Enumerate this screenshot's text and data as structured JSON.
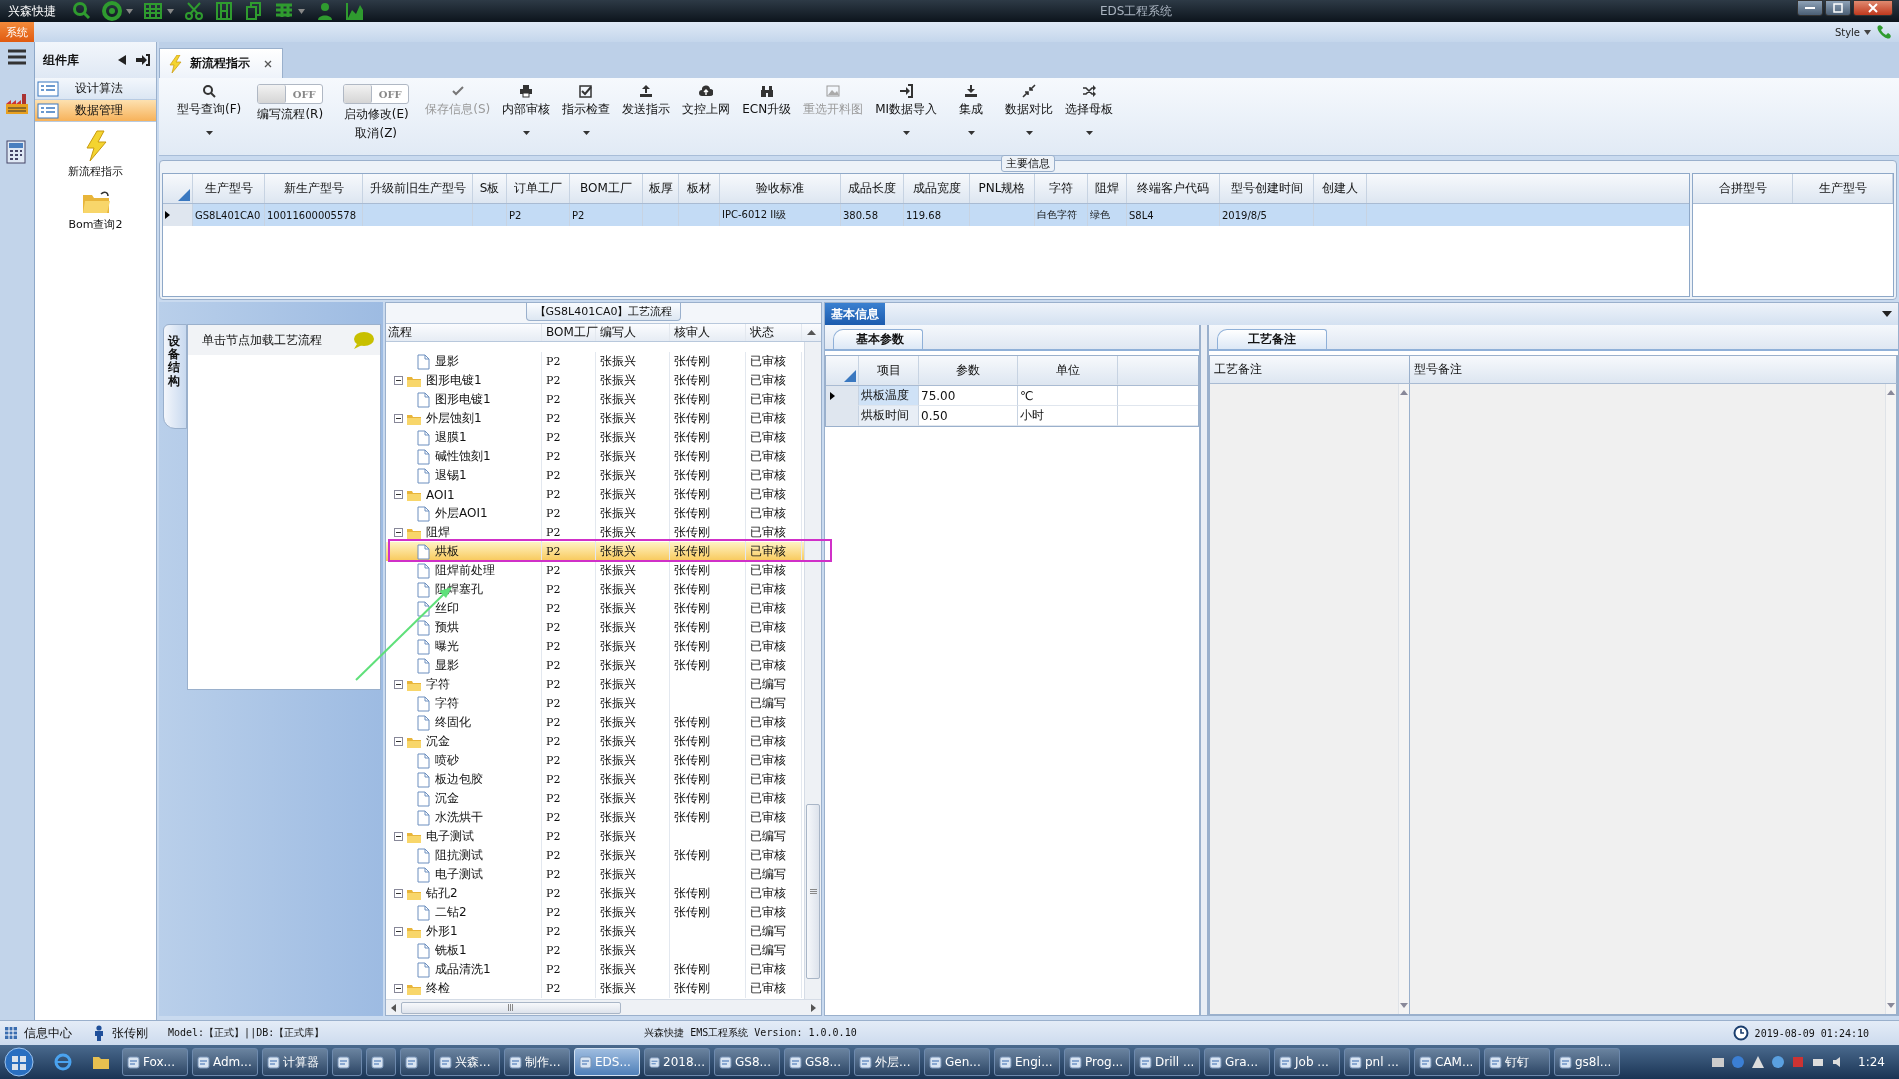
{
  "app": {
    "brand": "兴森快捷",
    "title": "EDS工程系统"
  },
  "ribbon": {
    "tab": "系统",
    "style_label": "Style"
  },
  "component_library": {
    "title": "组件库",
    "categories": [
      {
        "label": "设计算法",
        "selected": false
      },
      {
        "label": "数据管理",
        "selected": true
      }
    ],
    "items": [
      {
        "label": "新流程指示",
        "kind": "flash"
      },
      {
        "label": "Bom查询2",
        "kind": "folder"
      }
    ]
  },
  "document_tab": {
    "label": "新流程指示"
  },
  "toolbar": [
    {
      "kind": "button",
      "label": "型号查询(F)",
      "disabled": false,
      "dropdown": true
    },
    {
      "kind": "toggle",
      "label": "编写流程(R)",
      "state_text": "OFF",
      "on": false
    },
    {
      "kind": "toggle",
      "label": "启动修改(E)",
      "sublabel": "取消(Z)",
      "state_text": "OFF",
      "on": false
    },
    {
      "kind": "button",
      "label": "保存信息(S)",
      "disabled": true,
      "dropdown": false
    },
    {
      "kind": "button",
      "label": "内部审核",
      "disabled": false,
      "dropdown": true
    },
    {
      "kind": "button",
      "label": "指示检查",
      "disabled": false,
      "dropdown": true
    },
    {
      "kind": "button",
      "label": "发送指示",
      "disabled": false,
      "dropdown": false
    },
    {
      "kind": "button",
      "label": "文控上网",
      "disabled": false,
      "dropdown": false
    },
    {
      "kind": "button",
      "label": "ECN升级",
      "disabled": false,
      "dropdown": false
    },
    {
      "kind": "button",
      "label": "重选开料图",
      "disabled": true,
      "dropdown": false
    },
    {
      "kind": "button",
      "label": "MI数据导入",
      "disabled": false,
      "dropdown": true
    },
    {
      "kind": "button",
      "label": "集成",
      "disabled": false,
      "dropdown": true
    },
    {
      "kind": "button",
      "label": "数据对比",
      "disabled": false,
      "dropdown": true
    },
    {
      "kind": "button",
      "label": "选择母板",
      "disabled": false,
      "dropdown": true
    }
  ],
  "main_info": {
    "title": "主要信息",
    "columns": [
      "生产型号",
      "新生产型号",
      "升级前旧生产型号",
      "S板",
      "订单工厂",
      "BOM工厂",
      "板厚",
      "板材",
      "验收标准",
      "成品长度",
      "成品宽度",
      "PNL规格",
      "字符",
      "阻焊",
      "终端客户代码",
      "型号创建时间",
      "创建人"
    ],
    "rows": [
      {
        "selected": true,
        "cells": [
          "GS8L401CA0",
          "10011600005578",
          null,
          null,
          "P2",
          "P2",
          null,
          null,
          "IPC-6012 II级",
          "380.58",
          "119.68",
          null,
          "白色字符",
          "绿色",
          "S8L4",
          "2019/8/5",
          null
        ]
      }
    ],
    "merge_columns": [
      "合拼型号",
      "生产型号"
    ]
  },
  "side_panel": {
    "tab": "设备结构",
    "hint": "单击节点加载工艺流程"
  },
  "process_tree": {
    "title": "【GS8L401CA0】工艺流程",
    "columns": [
      "流程",
      "BOM工厂",
      "编写人",
      "核审人",
      "状态"
    ],
    "nodes": [
      {
        "children": [
          {
            "name": "显影",
            "bom": "P2",
            "writer": "张振兴",
            "reviewer": "张传刚",
            "status": "已审核",
            "selected": false
          }
        ]
      },
      {
        "name": "图形电镀1",
        "bom": "P2",
        "writer": "张振兴",
        "reviewer": "张传刚",
        "status": "已审核",
        "selected": false,
        "expanded": true,
        "children": [
          {
            "name": "图形电镀1",
            "bom": "P2",
            "writer": "张振兴",
            "reviewer": "张传刚",
            "status": "已审核",
            "selected": false
          }
        ]
      },
      {
        "name": "外层蚀刻1",
        "bom": "P2",
        "writer": "张振兴",
        "reviewer": "张传刚",
        "status": "已审核",
        "selected": false,
        "expanded": true,
        "children": [
          {
            "name": "退膜1",
            "bom": "P2",
            "writer": "张振兴",
            "reviewer": "张传刚",
            "status": "已审核",
            "selected": false
          },
          {
            "name": "碱性蚀刻1",
            "bom": "P2",
            "writer": "张振兴",
            "reviewer": "张传刚",
            "status": "已审核",
            "selected": false
          },
          {
            "name": "退锡1",
            "bom": "P2",
            "writer": "张振兴",
            "reviewer": "张传刚",
            "status": "已审核",
            "selected": false
          }
        ]
      },
      {
        "name": "AOI1",
        "bom": "P2",
        "writer": "张振兴",
        "reviewer": "张传刚",
        "status": "已审核",
        "selected": false,
        "expanded": true,
        "children": [
          {
            "name": "外层AOI1",
            "bom": "P2",
            "writer": "张振兴",
            "reviewer": "张传刚",
            "status": "已审核",
            "selected": false
          }
        ]
      },
      {
        "name": "阻焊",
        "bom": "P2",
        "writer": "张振兴",
        "reviewer": "张传刚",
        "status": "已审核",
        "selected": false,
        "expanded": true,
        "children": [
          {
            "name": "烘板",
            "bom": "P2",
            "writer": "张振兴",
            "reviewer": "张传刚",
            "status": "已审核",
            "selected": true
          },
          {
            "name": "阻焊前处理",
            "bom": "P2",
            "writer": "张振兴",
            "reviewer": "张传刚",
            "status": "已审核",
            "selected": false
          },
          {
            "name": "阻焊塞孔",
            "bom": "P2",
            "writer": "张振兴",
            "reviewer": "张传刚",
            "status": "已审核",
            "selected": false
          },
          {
            "name": "丝印",
            "bom": "P2",
            "writer": "张振兴",
            "reviewer": "张传刚",
            "status": "已审核",
            "selected": false
          },
          {
            "name": "预烘",
            "bom": "P2",
            "writer": "张振兴",
            "reviewer": "张传刚",
            "status": "已审核",
            "selected": false
          },
          {
            "name": "曝光",
            "bom": "P2",
            "writer": "张振兴",
            "reviewer": "张传刚",
            "status": "已审核",
            "selected": false
          },
          {
            "name": "显影",
            "bom": "P2",
            "writer": "张振兴",
            "reviewer": "张传刚",
            "status": "已审核",
            "selected": false
          }
        ]
      },
      {
        "name": "字符",
        "bom": "P2",
        "writer": "张振兴",
        "status": "已编写",
        "selected": false,
        "expanded": true,
        "children": [
          {
            "name": "字符",
            "bom": "P2",
            "writer": "张振兴",
            "status": "已编写",
            "selected": false
          },
          {
            "name": "终固化",
            "bom": "P2",
            "writer": "张振兴",
            "reviewer": "张传刚",
            "status": "已审核",
            "selected": false
          }
        ]
      },
      {
        "name": "沉金",
        "bom": "P2",
        "writer": "张振兴",
        "reviewer": "张传刚",
        "status": "已审核",
        "selected": false,
        "expanded": true,
        "children": [
          {
            "name": "喷砂",
            "bom": "P2",
            "writer": "张振兴",
            "reviewer": "张传刚",
            "status": "已审核",
            "selected": false
          },
          {
            "name": "板边包胶",
            "bom": "P2",
            "writer": "张振兴",
            "reviewer": "张传刚",
            "status": "已审核",
            "selected": false
          },
          {
            "name": "沉金",
            "bom": "P2",
            "writer": "张振兴",
            "reviewer": "张传刚",
            "status": "已审核",
            "selected": false
          },
          {
            "name": "水洗烘干",
            "bom": "P2",
            "writer": "张振兴",
            "reviewer": "张传刚",
            "status": "已审核",
            "selected": false
          }
        ]
      },
      {
        "name": "电子测试",
        "bom": "P2",
        "writer": "张振兴",
        "status": "已编写",
        "selected": false,
        "expanded": true,
        "children": [
          {
            "name": "阻抗测试",
            "bom": "P2",
            "writer": "张振兴",
            "reviewer": "张传刚",
            "status": "已审核",
            "selected": false
          },
          {
            "name": "电子测试",
            "bom": "P2",
            "writer": "张振兴",
            "status": "已编写",
            "selected": false
          }
        ]
      },
      {
        "name": "钻孔2",
        "bom": "P2",
        "writer": "张振兴",
        "reviewer": "张传刚",
        "status": "已审核",
        "selected": false,
        "expanded": true,
        "children": [
          {
            "name": "二钻2",
            "bom": "P2",
            "writer": "张振兴",
            "reviewer": "张传刚",
            "status": "已审核",
            "selected": false
          }
        ]
      },
      {
        "name": "外形1",
        "bom": "P2",
        "writer": "张振兴",
        "status": "已编写",
        "selected": false,
        "expanded": true,
        "children": [
          {
            "name": "铣板1",
            "bom": "P2",
            "writer": "张振兴",
            "status": "已编写",
            "selected": false
          },
          {
            "name": "成品清洗1",
            "bom": "P2",
            "writer": "张振兴",
            "reviewer": "张传刚",
            "status": "已审核",
            "selected": false
          }
        ]
      },
      {
        "name": "终检",
        "bom": "P2",
        "writer": "张振兴",
        "reviewer": "张传刚",
        "status": "已审核",
        "selected": false,
        "expanded": true
      }
    ]
  },
  "basic_info": {
    "tab": "基本信息",
    "params": {
      "tab": "基本参数",
      "columns": [
        "项目",
        "参数",
        "单位"
      ],
      "rows": [
        {
          "current": true,
          "cells": [
            "烘板温度",
            "75.00",
            "℃"
          ]
        },
        {
          "current": false,
          "cells": [
            "烘板时间",
            "0.50",
            "小时"
          ]
        }
      ]
    },
    "notes": {
      "tab": "工艺备注",
      "columns": [
        "工艺备注",
        "型号备注"
      ]
    }
  },
  "annotations": {
    "highlight_frame": true,
    "pointer_arrow": true
  },
  "status_bar": {
    "center": "信息中心",
    "user": "张传刚",
    "model": "Model:【正式】||DB:【正式库】",
    "product": "兴森快捷 EMS工程系统 Version: 1.0.0.10",
    "datetime": "2019-08-09 01:24:10"
  },
  "taskbar": {
    "tasks": [
      {
        "label": "Fox...",
        "active": false
      },
      {
        "label": "Adm...",
        "active": false
      },
      {
        "label": "计算器",
        "active": false
      },
      {
        "active": false
      },
      {
        "active": false
      },
      {
        "active": false
      },
      {
        "label": "兴森...",
        "active": false
      },
      {
        "label": "制作...",
        "active": false
      },
      {
        "label": "EDS...",
        "active": true
      },
      {
        "label": "2018...",
        "active": false
      },
      {
        "label": "GS8...",
        "active": false
      },
      {
        "label": "GS8...",
        "active": false
      },
      {
        "label": "外层...",
        "active": false
      },
      {
        "label": "Gen...",
        "active": false
      },
      {
        "label": "Engi...",
        "active": false
      },
      {
        "label": "Prog...",
        "active": false
      },
      {
        "label": "Drill ...",
        "active": false
      },
      {
        "label": "Gra...",
        "active": false
      },
      {
        "label": "Job ...",
        "active": false
      },
      {
        "label": "pnl ...",
        "active": false
      },
      {
        "label": "CAM...",
        "active": false
      },
      {
        "label": "钉钉",
        "active": false
      },
      {
        "label": "gs8l...",
        "active": false
      }
    ],
    "clock": "1:24"
  }
}
